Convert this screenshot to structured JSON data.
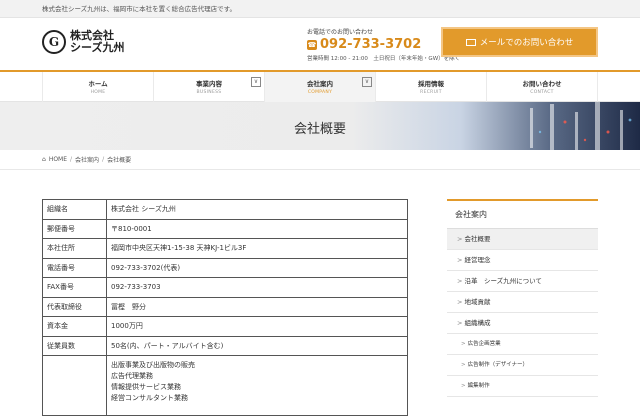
{
  "topbar": {
    "text": "株式会社シーズ九州は、福岡市に本社を置く総合広告代理店です。"
  },
  "header": {
    "logo_mark": "G",
    "logo_line1": "株式会社",
    "logo_line2": "シーズ九州",
    "phone_label": "お電話でのお問い合わせ",
    "phone_number": "092-733-3702",
    "phone_hours": "営業時間 12:00 - 21:00　土日祝日（年末年始・GW）を除く",
    "mail_button": "メールでのお問い合わせ"
  },
  "nav": [
    {
      "label": "ホーム",
      "sub": "HOME"
    },
    {
      "label": "事業内容",
      "sub": "BUSINESS",
      "toggle": "∨"
    },
    {
      "label": "会社案内",
      "sub": "COMPANY",
      "toggle": "∨"
    },
    {
      "label": "採用情報",
      "sub": "RECRUIT"
    },
    {
      "label": "お問い合わせ",
      "sub": "CONTACT"
    }
  ],
  "hero": {
    "title": "会社概要"
  },
  "breadcrumb": {
    "home": "HOME",
    "level1": "会社案内",
    "current": "会社概要",
    "sep": "/"
  },
  "company_table": [
    {
      "key": "組織名",
      "value": "株式会社 シーズ九州"
    },
    {
      "key": "郵便番号",
      "value": "〒810-0001"
    },
    {
      "key": "本社住所",
      "value": "福岡市中央区天神1-15-38 天神KJ-1ビル3F"
    },
    {
      "key": "電話番号",
      "value": "092-733-3702(代表)"
    },
    {
      "key": "FAX番号",
      "value": "092-733-3703"
    },
    {
      "key": "代表取締役",
      "value": "冨樫　野分"
    },
    {
      "key": "資本金",
      "value": "1000万円"
    },
    {
      "key": "従業員数",
      "value": "50名(内、パート・アルバイト含む)"
    }
  ],
  "business": {
    "lines": [
      "出版事業及び出版物の販売",
      "広告代理業務",
      "情報提供サービス業務",
      "経営コンサルタント業務"
    ]
  },
  "sidebar": {
    "title": "会社案内",
    "items": [
      {
        "label": "会社概要"
      },
      {
        "label": "経営理念"
      },
      {
        "label": "沿革　シーズ九州について"
      },
      {
        "label": "地域貢献"
      },
      {
        "label": "組織構成"
      },
      {
        "label": "広告企画営業"
      },
      {
        "label": "広告制作（デザイナー）"
      },
      {
        "label": "編集制作"
      }
    ],
    "chevron": ">"
  }
}
